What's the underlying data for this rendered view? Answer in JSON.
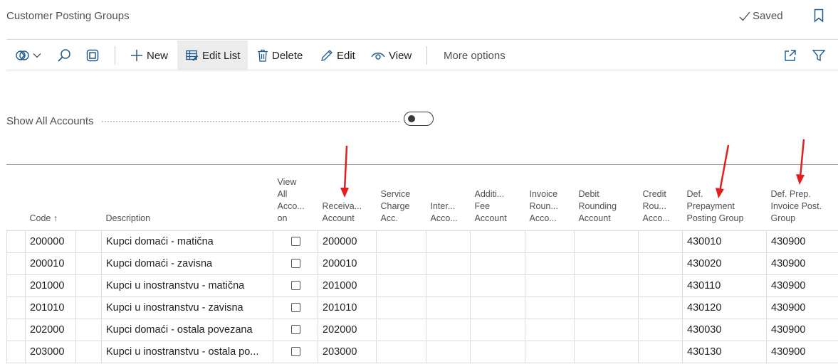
{
  "header": {
    "title": "Customer Posting Groups",
    "saved_label": "Saved"
  },
  "toolbar": {
    "new_label": "New",
    "edit_list_label": "Edit List",
    "delete_label": "Delete",
    "edit_label": "Edit",
    "view_label": "View",
    "more_options_label": "More options"
  },
  "filter": {
    "show_all_accounts_label": "Show All Accounts",
    "show_all_accounts_value": false
  },
  "table": {
    "headers": {
      "code": "Code",
      "code_sort": "↑",
      "description": "Description",
      "view_all": [
        "View",
        "All",
        "Acco...",
        "on"
      ],
      "receivables": [
        "Receiva...",
        "Account"
      ],
      "service_charge": [
        "Service",
        "Charge",
        "Acc."
      ],
      "interest": [
        "Inter...",
        "Acco..."
      ],
      "additional_fee": [
        "Additi...",
        "Fee",
        "Account"
      ],
      "invoice_rounding": [
        "Invoice",
        "Roun...",
        "Acco..."
      ],
      "debit_rounding": [
        "Debit",
        "Rounding",
        "Account"
      ],
      "credit_rounding": [
        "Credit",
        "Rou...",
        "Acco..."
      ],
      "def_prepayment": [
        "Def.",
        "Prepayment",
        "Posting Group"
      ],
      "def_prep_invoice": [
        "Def. Prep.",
        "Invoice Post.",
        "Group"
      ]
    },
    "rows": [
      {
        "code": "200000",
        "description": "Kupci domaći - matična",
        "receivables": "200000",
        "def_prepayment": "430010",
        "def_prep_invoice": "430900"
      },
      {
        "code": "200010",
        "description": "Kupci domaći - zavisna",
        "receivables": "200010",
        "def_prepayment": "430020",
        "def_prep_invoice": "430900"
      },
      {
        "code": "201000",
        "description": "Kupci u inostranstvu - matična",
        "receivables": "201000",
        "def_prepayment": "430110",
        "def_prep_invoice": "430900"
      },
      {
        "code": "201010",
        "description": "Kupci u inostranstvu - zavisna",
        "receivables": "201010",
        "def_prepayment": "430120",
        "def_prep_invoice": "430900"
      },
      {
        "code": "202000",
        "description": "Kupci domaći - ostala povezana",
        "receivables": "202000",
        "def_prepayment": "430030",
        "def_prep_invoice": "430900"
      },
      {
        "code": "203000",
        "description": "Kupci u inostranstvu - ostala po...",
        "receivables": "203000",
        "def_prepayment": "430130",
        "def_prep_invoice": "430900"
      }
    ]
  },
  "icons": [
    "analyze-icon",
    "search-icon",
    "filter-pane-icon",
    "plus-icon",
    "edit-list-icon",
    "trash-icon",
    "pencil-icon",
    "eye-icon",
    "share-icon",
    "filter-icon",
    "checkmark-icon",
    "bookmark-icon"
  ],
  "colors": {
    "annotation_arrow": "#e02020",
    "active_button_bg": "#ececec"
  }
}
